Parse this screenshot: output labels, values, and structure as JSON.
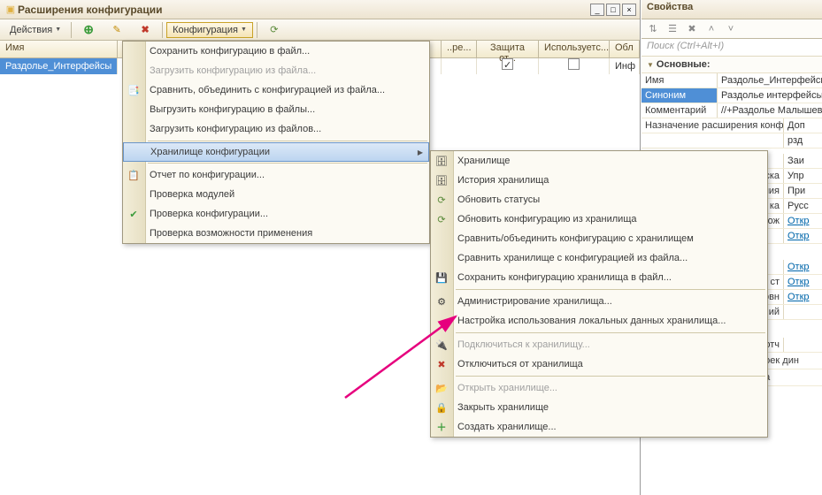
{
  "left": {
    "title": "Расширения конфигурации",
    "actions_label": "Действия",
    "config_label": "Конфигурация",
    "cols": {
      "name": "Имя",
      "ex": "..ре...",
      "zsh": "Защита от...",
      "isp": "Используетс...",
      "obl": "Обл"
    },
    "row": {
      "name": "Раздолье_Интерфейсы",
      "zsh_checked": true,
      "isp_checked": false,
      "obl": "Инф"
    }
  },
  "menu1": {
    "items": [
      {
        "label": "Сохранить конфигурацию в файл..."
      },
      {
        "label": "Загрузить конфигурацию из файла...",
        "disabled": true
      },
      {
        "label": "Сравнить, объединить с конфигурацией из файла...",
        "icon": "📑"
      },
      {
        "label": "Выгрузить конфигурацию в файлы..."
      },
      {
        "label": "Загрузить конфигурацию из файлов..."
      }
    ],
    "submenu_label": "Хранилище конфигурации",
    "items2": [
      {
        "label": "Отчет по конфигурации...",
        "icon": "📋"
      },
      {
        "label": "Проверка модулей"
      },
      {
        "label": "Проверка конфигурации...",
        "icon": "✔"
      },
      {
        "label": "Проверка возможности применения"
      }
    ]
  },
  "menu2": {
    "g1": [
      {
        "label": "Хранилище",
        "icon": "🗄"
      },
      {
        "label": "История хранилища",
        "icon": "🗄"
      },
      {
        "label": "Обновить статусы",
        "icon": "⟳"
      },
      {
        "label": "Обновить конфигурацию из хранилища",
        "icon": "⟳"
      },
      {
        "label": "Сравнить/объединить конфигурацию с хранилищем"
      },
      {
        "label": "Сравнить хранилище с конфигурацией из файла..."
      },
      {
        "label": "Сохранить конфигурацию хранилища в файл...",
        "icon": "💾"
      }
    ],
    "g2": [
      {
        "label": "Администрирование хранилища...",
        "icon": "⚙"
      },
      {
        "label": "Настройка использования локальных данных хранилища..."
      }
    ],
    "g3": [
      {
        "label": "Подключиться к хранилищу...",
        "disabled": true,
        "icon": "🔌"
      },
      {
        "label": "Отключиться от хранилища",
        "icon": "✖"
      }
    ],
    "g4": [
      {
        "label": "Открыть хранилище...",
        "disabled": true,
        "icon": "📂"
      },
      {
        "label": "Закрыть хранилище",
        "icon": "🔒"
      },
      {
        "label": "Создать хранилище...",
        "icon": "＋"
      }
    ]
  },
  "right": {
    "title": "Свойства",
    "search_placeholder": "Поиск (Ctrl+Alt+I)",
    "group_main": "Основные:",
    "rows": {
      "name_lbl": "Имя",
      "name_val": "Раздолье_Интерфейсь",
      "syn_lbl": "Синоним",
      "syn_val": "Раздолье интерфейсы",
      "comm_lbl": "Комментарий",
      "comm_val": "//+Раздолье Малышев",
      "nazn_lbl": "Назначение расширения конфиг",
      "nazn_val": "Доп",
      "rzd": "рзд",
      "zai": "Заи",
      "ska": "ска",
      "ska_val": "Упр",
      "vania": "вания",
      "vania_val": "При",
      "ka": "ка",
      "ka_val": "Русс",
      "prilog": "прилож",
      "prilog_val": "Откр",
      "otkr2": "Откр",
      "otkr3": "Откр",
      "lnoy": "льной ст",
      "lnoy_val": "Откр",
      "osnovi": "основн",
      "osnovi_val": "Откр",
      "ij": "ий",
      "rep1": "ерь отч",
      "form_nastr": "Основная форма настроек дин",
      "form_poisk": "Основная форма поиска"
    }
  }
}
